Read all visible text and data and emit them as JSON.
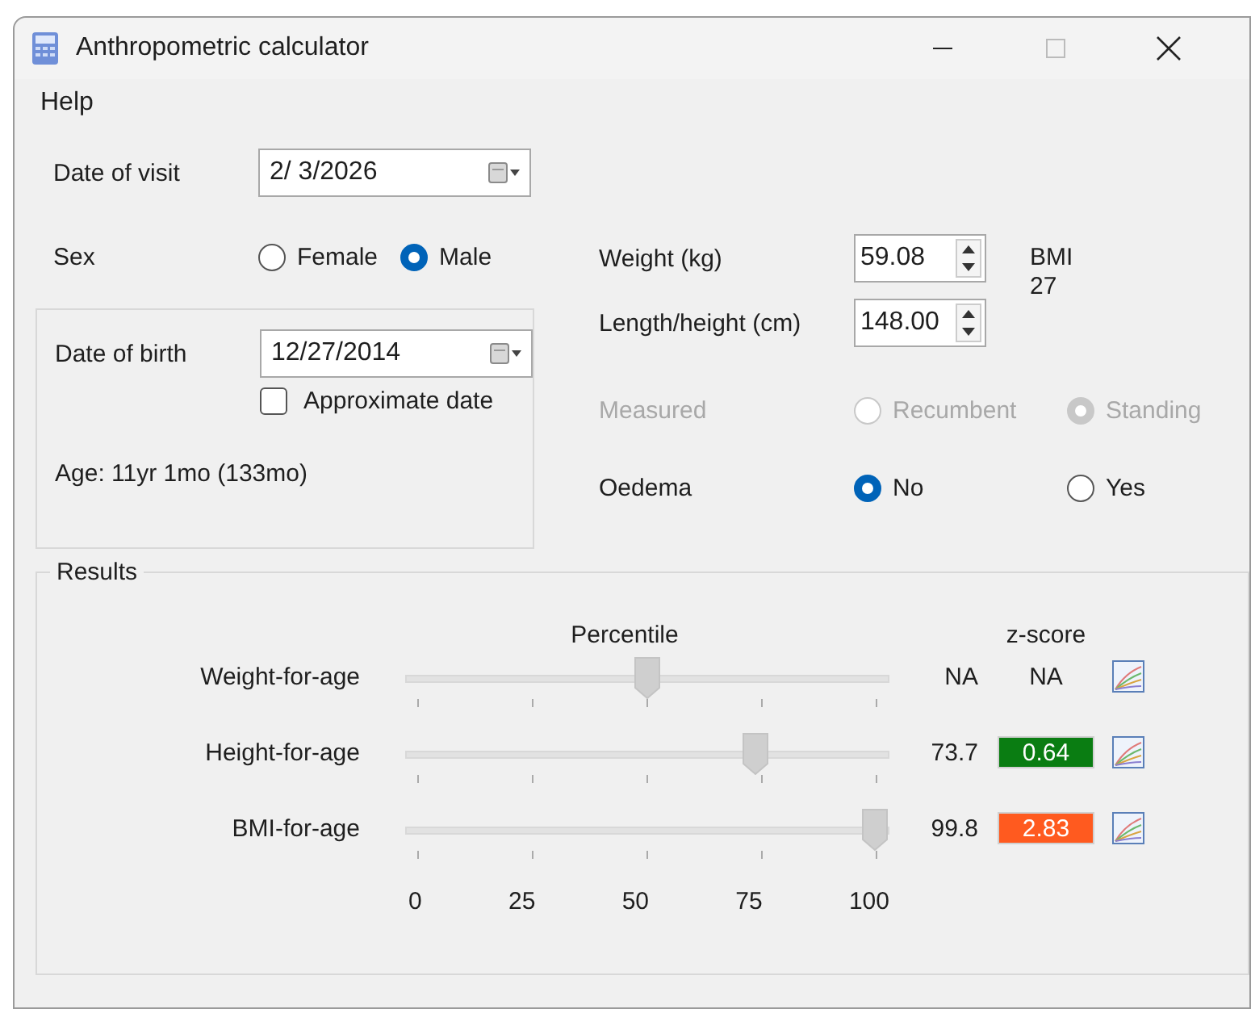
{
  "window": {
    "title": "Anthropometric calculator"
  },
  "menu": [
    {
      "label": "Help"
    }
  ],
  "date_of_visit": {
    "label": "Date of visit",
    "value": "2/ 3/2026"
  },
  "sex": {
    "label": "Sex",
    "options": [
      {
        "label": "Female",
        "selected": false
      },
      {
        "label": "Male",
        "selected": true
      }
    ]
  },
  "date_of_birth": {
    "label": "Date of birth",
    "value": "12/27/2014",
    "approximate": {
      "label": "Approximate date",
      "checked": false
    },
    "age": "Age: 11yr 1mo (133mo)"
  },
  "weight": {
    "label": "Weight (kg)",
    "value": "59.08"
  },
  "height": {
    "label": "Length/height (cm)",
    "value": "148.00"
  },
  "bmi": {
    "label": "BMI",
    "value": "27"
  },
  "measured": {
    "label": "Measured",
    "disabled": true,
    "options": [
      {
        "label": "Recumbent",
        "selected": false
      },
      {
        "label": "Standing",
        "selected": true
      }
    ]
  },
  "oedema": {
    "label": "Oedema",
    "disabled": false,
    "options": [
      {
        "label": "No",
        "selected": true
      },
      {
        "label": "Yes",
        "selected": false
      }
    ]
  },
  "results": {
    "title": "Results",
    "percentile_header": "Percentile",
    "zscore_header": "z-score",
    "rows": [
      {
        "label": "Weight-for-age",
        "level": 0.5,
        "percentile": "NA",
        "zscore": "NA"
      },
      {
        "label": "Height-for-age",
        "level": 0.737,
        "percentile": "73.7",
        "zscore": "0.64",
        "color": "#0a7d12"
      },
      {
        "label": "BMI-for-age",
        "level": 0.998,
        "percentile": "99.8",
        "zscore": "2.83",
        "color": "#ff5a1f"
      }
    ],
    "scale": [
      "0",
      "25",
      "50",
      "75",
      "100"
    ]
  }
}
